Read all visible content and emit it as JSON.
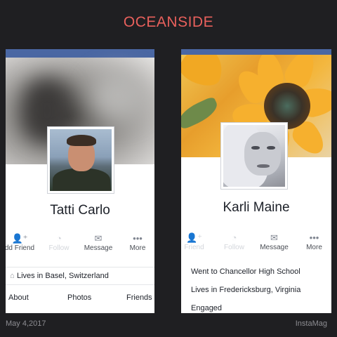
{
  "header": {
    "title": "OCEANSIDE"
  },
  "left_profile": {
    "name": "Tatti Carlo",
    "actions": [
      {
        "label": "dd Friend",
        "icon": "add-friend-icon",
        "faint": false
      },
      {
        "label": "Follow",
        "icon": "follow-icon",
        "faint": true
      },
      {
        "label": "Message",
        "icon": "message-icon",
        "faint": false
      },
      {
        "label": "More",
        "icon": "more-icon",
        "faint": false
      }
    ],
    "location": "Lives in Basel, Switzerland",
    "tabs": [
      "About",
      "Photos",
      "Friends"
    ]
  },
  "right_profile": {
    "name": "Karli Maine",
    "actions": [
      {
        "label": "Friend",
        "icon": "add-friend-icon",
        "faint": true
      },
      {
        "label": "Follow",
        "icon": "follow-icon",
        "faint": true
      },
      {
        "label": "Message",
        "icon": "message-icon",
        "faint": false
      },
      {
        "label": "More",
        "icon": "more-icon",
        "faint": false
      }
    ],
    "details": [
      "Went to Chancellor High School",
      "Lives in Fredericksburg, Virginia",
      "Engaged"
    ]
  },
  "footer": {
    "date": "May 4,2017",
    "app": "InstaMag"
  },
  "colors": {
    "title": "#e8605c",
    "facebook_blue": "#4a67a3",
    "background": "#1f1f22"
  }
}
